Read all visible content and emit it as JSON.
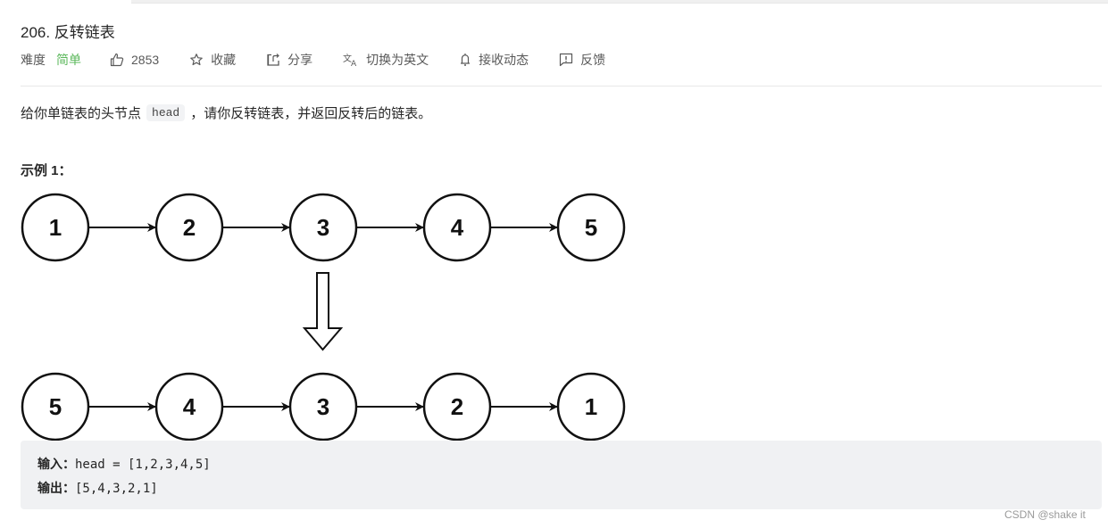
{
  "problem": {
    "title": "206. 反转链表",
    "difficulty_label": "难度",
    "difficulty_value": "简单",
    "colors": {
      "difficulty_easy": "#5cb85c",
      "code_bg": "#f0f1f3"
    }
  },
  "actions": {
    "likes": "2853",
    "favorite": "收藏",
    "share": "分享",
    "switch_language": "切换为英文",
    "subscribe": "接收动态",
    "feedback": "反馈"
  },
  "description": {
    "before": "给你单链表的头节点",
    "code": "head",
    "after": "，请你反转链表，并返回反转后的链表。"
  },
  "example": {
    "title": "示例 1：",
    "diagram": {
      "original": [
        "1",
        "2",
        "3",
        "4",
        "5"
      ],
      "reversed": [
        "5",
        "4",
        "3",
        "2",
        "1"
      ]
    },
    "input_label": "输入：",
    "input_value": "head = [1,2,3,4,5]",
    "output_label": "输出：",
    "output_value": "[5,4,3,2,1]"
  },
  "watermark": "CSDN @shake it"
}
